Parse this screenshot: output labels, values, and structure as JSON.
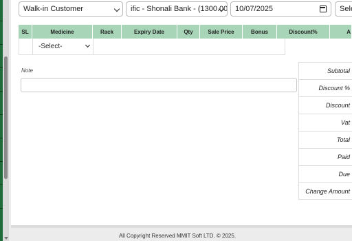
{
  "top": {
    "customer": "Walk-in Customer",
    "bank": "ific - Shonali Bank - (1300.00)",
    "date": "10/07/2025",
    "select": "Sele"
  },
  "table": {
    "headers": [
      "SL",
      "Medicine",
      "Rack",
      "Expiry Date",
      "Qty",
      "Sale Price",
      "Bonus",
      "Discount%",
      "A"
    ],
    "medicine_select": "-Select-"
  },
  "note": {
    "label": "Note",
    "value": ""
  },
  "summary": {
    "labels": [
      "Subtotal",
      "Discount %",
      "Discount",
      "Vat",
      "Total",
      "Paid",
      "Due",
      "Change Amount"
    ]
  },
  "footer": {
    "text": "All Copyright Reserved MMIT Soft LTD. © 2025."
  },
  "colors": {
    "header_bg": "#a8d5b8",
    "sidebar": "#1f6b3a"
  }
}
